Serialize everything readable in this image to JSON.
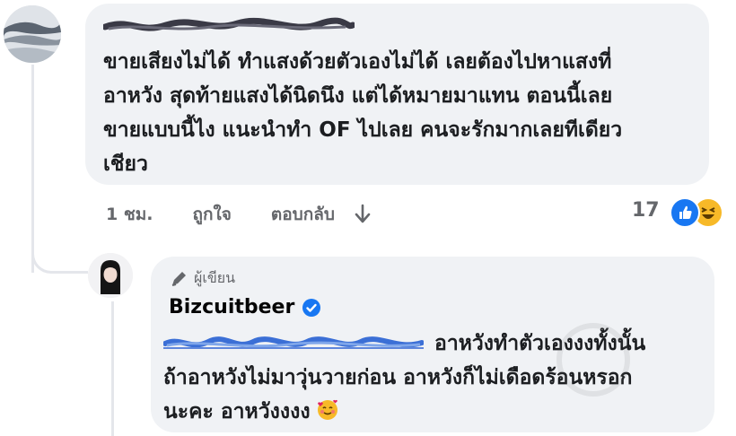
{
  "comment": {
    "text_lines": [
      "ขายเสียงไม่ได้ ทำแสงด้วยตัวเองไม่ได้ เลยต้องไปหาแสงที่",
      "อาหวัง สุดท้ายแสงได้นิดนึง แต่ได้หมายมาแทน ตอนนี้เลย",
      "ขายแบบนี้ไง แนะนำทำ OF ไปเลย คนจะรักมากเลยทีเดียว",
      "เชียว"
    ],
    "time": "1 ชม.",
    "like_label": "ถูกใจ",
    "reply_label": "ตอบกลับ",
    "reaction_count": "17",
    "reaction_icons": [
      "like-icon",
      "haha-icon"
    ]
  },
  "reply": {
    "author_badge": "ผู้เขียน",
    "name": "Bizcuitbeer",
    "text_line1": "อาหวังทำตัวเองงงทั้งนั้น",
    "text_line2": "ถ้าอาหวังไม่มาวุ่นวายก่อน อาหวังก็ไม่เดือดร้อนหรอก",
    "text_line3": "นะคะ อาหวังงงง",
    "emoji": "smiling-face-with-hearts-icon"
  },
  "colors": {
    "bubble": "#f0f2f5",
    "secondary_text": "#65676b",
    "like_blue": "#1877f2",
    "haha_yellow": "#f7b928",
    "scribble_blue": "#3b6fd6"
  }
}
